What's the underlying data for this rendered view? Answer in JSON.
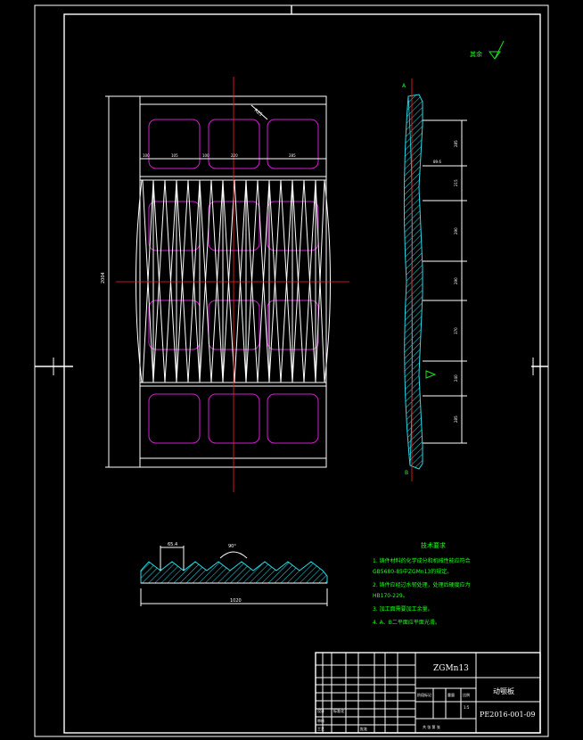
{
  "roughness": {
    "label": "其余",
    "symbol": "▽"
  },
  "tech_req": {
    "title": "技术要求",
    "lines": [
      "1. 铸件材料的化学成分和机械性能应符合",
      "GB5680-85中ZGMn13的规定。",
      "2. 铸件应经过水韧处理，处理后硬度应为",
      "HB170-229。",
      "3. 加工面需要加工余量。",
      "4. A、B二平面应平面光滑。"
    ]
  },
  "title_block": {
    "material": "ZGMn13",
    "part_name": "动颚板",
    "drawing_no": "PE2016-001-09",
    "scale": "1:5",
    "labels": [
      "设计",
      "标准化",
      "审核",
      "工艺",
      "批准",
      "阶段标记",
      "重量",
      "比例",
      "共  张  第  张"
    ]
  },
  "dimensions": {
    "top_row": [
      "100",
      "105",
      "100",
      "220",
      "285"
    ],
    "side": [
      "285",
      "215",
      "290",
      "290",
      "370",
      "240",
      "285"
    ],
    "overall_height": "2004",
    "bottom_width": "1020",
    "pitch": "65.4",
    "angle": "90°",
    "thickness": "89.6",
    "radius": "R25"
  },
  "labels": {
    "a": "A",
    "b": "B"
  }
}
